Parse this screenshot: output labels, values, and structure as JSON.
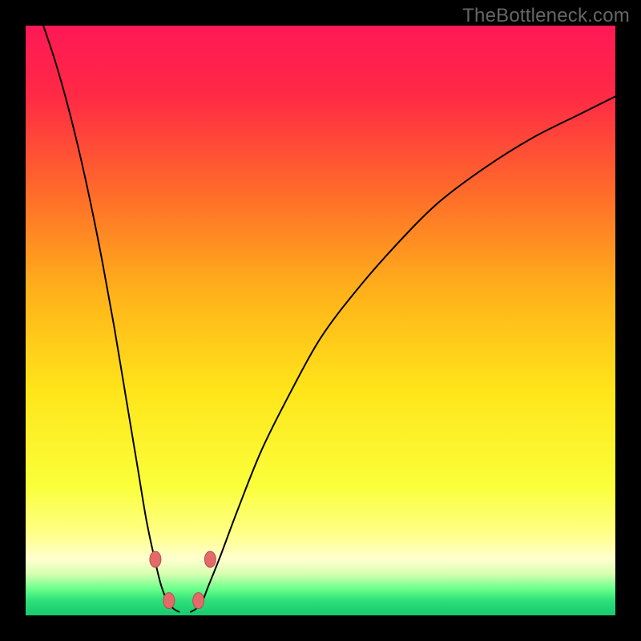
{
  "watermark": "TheBottleneck.com",
  "chart_data": {
    "type": "line",
    "title": "",
    "xlabel": "",
    "ylabel": "",
    "xlim": [
      0,
      100
    ],
    "ylim": [
      0,
      100
    ],
    "grid": false,
    "background_gradient": {
      "stops": [
        {
          "offset": 0.0,
          "color": "#ff1856"
        },
        {
          "offset": 0.12,
          "color": "#ff2a45"
        },
        {
          "offset": 0.28,
          "color": "#ff6a2a"
        },
        {
          "offset": 0.45,
          "color": "#ffb11a"
        },
        {
          "offset": 0.62,
          "color": "#ffe51a"
        },
        {
          "offset": 0.78,
          "color": "#faff3a"
        },
        {
          "offset": 0.86,
          "color": "#ffff85"
        },
        {
          "offset": 0.905,
          "color": "#ffffd0"
        },
        {
          "offset": 0.93,
          "color": "#d6ffb0"
        },
        {
          "offset": 0.955,
          "color": "#6aff8a"
        },
        {
          "offset": 0.975,
          "color": "#2de07a"
        },
        {
          "offset": 1.0,
          "color": "#18c96e"
        }
      ]
    },
    "series": [
      {
        "name": "left-branch",
        "stroke": "#000000",
        "stroke_width": 2,
        "x": [
          3.0,
          5.0,
          7.0,
          9.0,
          11.0,
          13.0,
          15.0,
          17.0,
          19.0,
          20.5,
          22.0,
          23.0,
          24.0,
          25.0,
          26.0
        ],
        "y": [
          100.0,
          94.0,
          87.0,
          79.0,
          70.0,
          60.0,
          49.0,
          37.0,
          25.0,
          16.0,
          9.0,
          5.0,
          2.5,
          1.2,
          0.6
        ]
      },
      {
        "name": "right-branch",
        "stroke": "#000000",
        "stroke_width": 2,
        "x": [
          28.0,
          29.0,
          30.0,
          31.0,
          33.0,
          36.0,
          40.0,
          45.0,
          50.0,
          56.0,
          63.0,
          70.0,
          78.0,
          86.0,
          94.0,
          100.0
        ],
        "y": [
          0.6,
          1.2,
          2.5,
          5.0,
          10.0,
          18.0,
          28.0,
          38.0,
          47.0,
          55.0,
          63.0,
          70.0,
          76.0,
          81.0,
          85.0,
          88.0
        ]
      }
    ],
    "marker_sets": [
      {
        "name": "valley-markers",
        "fill": "#e46a6a",
        "stroke": "#b84d4d",
        "rx": 7,
        "ry": 10,
        "points": [
          {
            "x": 22.0,
            "y": 9.5
          },
          {
            "x": 24.3,
            "y": 2.5
          },
          {
            "x": 29.3,
            "y": 2.5
          },
          {
            "x": 31.3,
            "y": 9.5
          }
        ]
      }
    ]
  }
}
